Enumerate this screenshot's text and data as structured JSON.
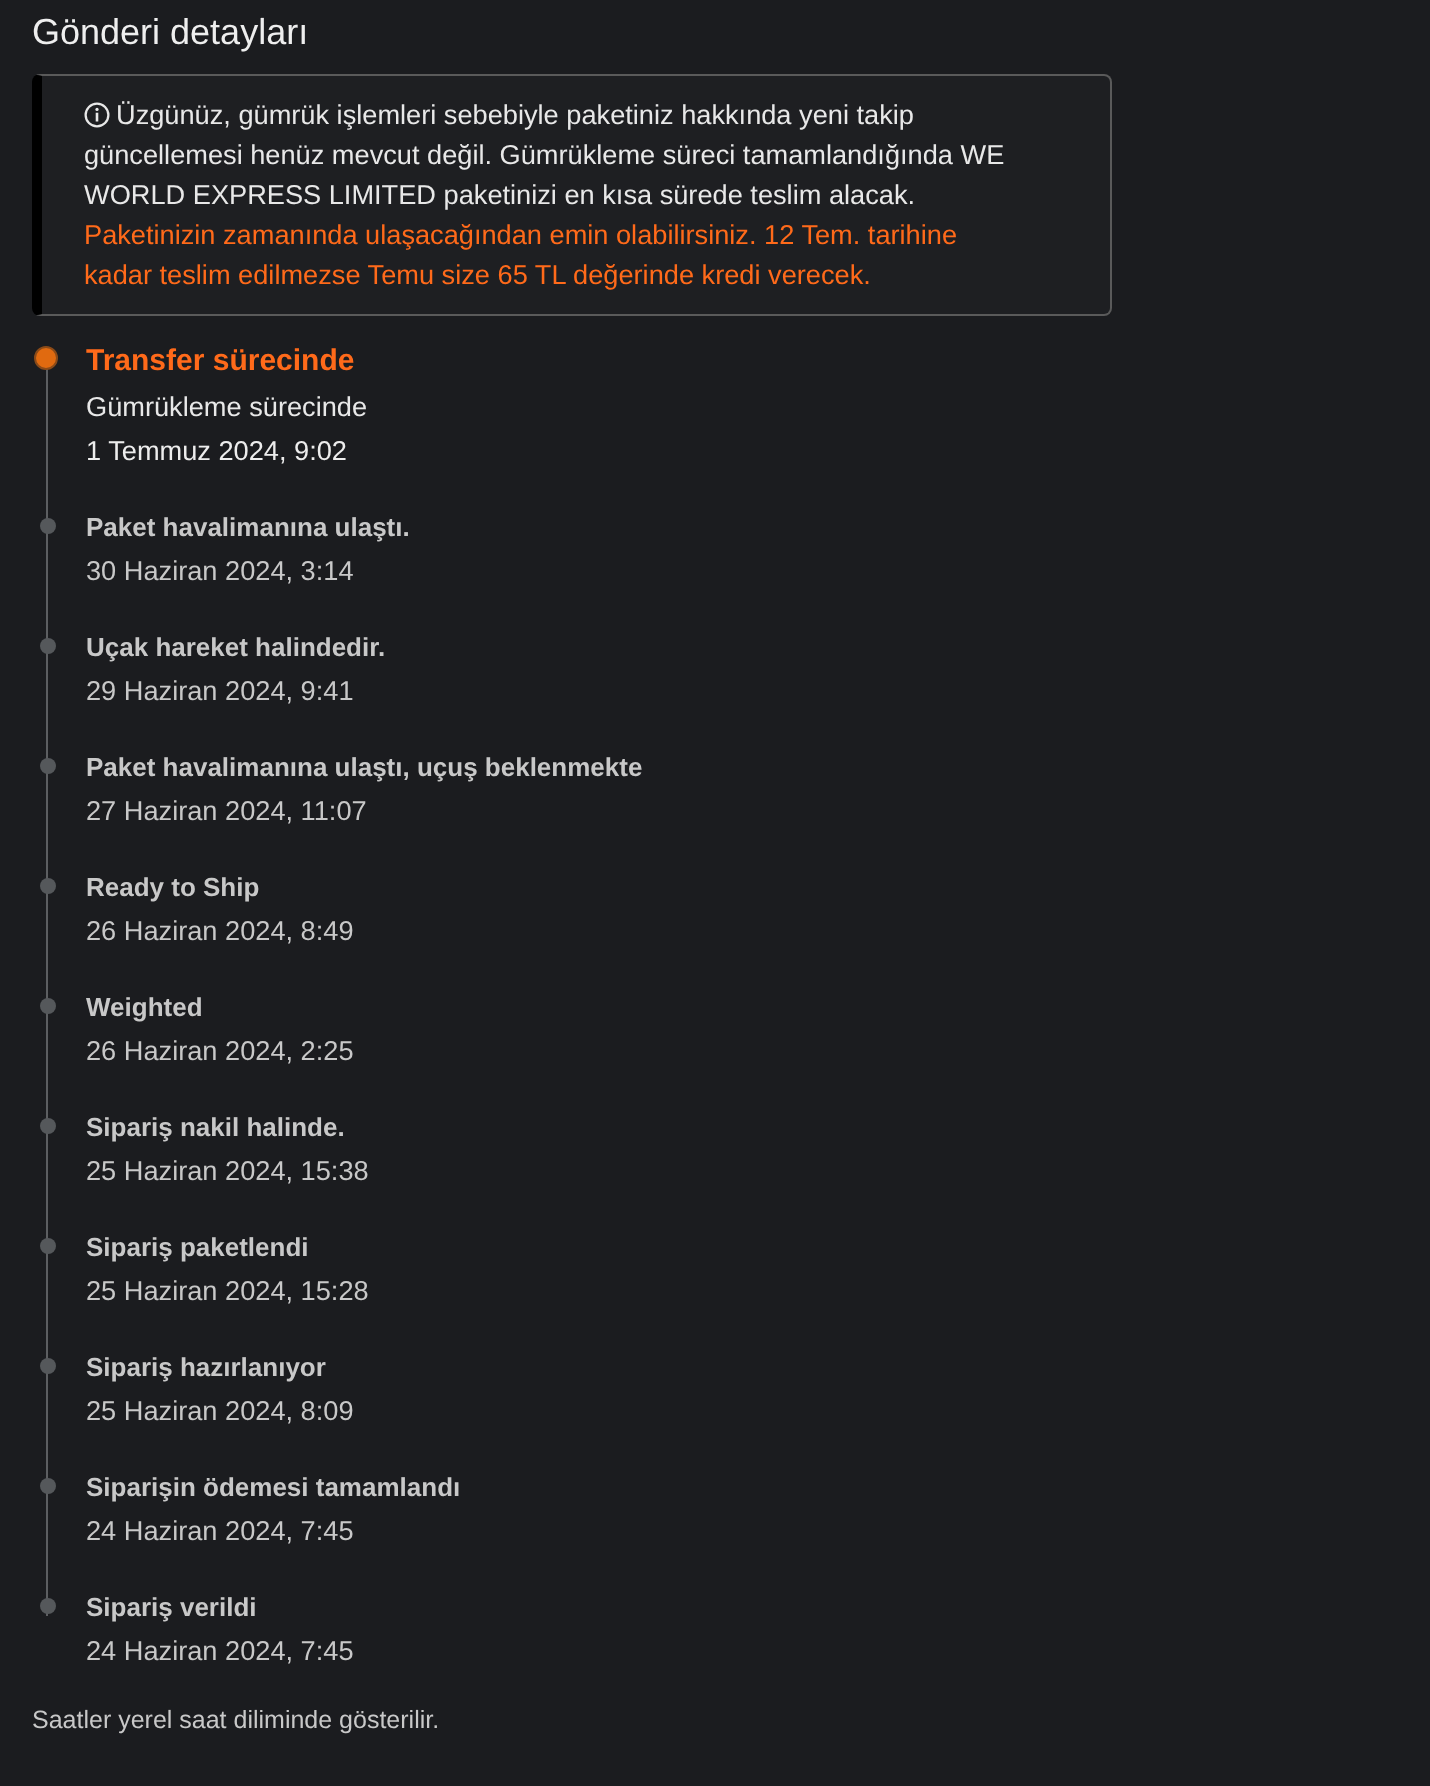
{
  "title": "Gönderi detayları",
  "notice": {
    "text": "Üzgünüz, gümrük işlemleri sebebiyle paketiniz hakkında yeni takip güncellemesi henüz mevcut değil. Gümrükleme süreci tamamlandığında WE WORLD EXPRESS LIMITED paketinizi en kısa sürede teslim alacak.",
    "highlight": "Paketinizin zamanında ulaşacağından emin olabilirsiniz. 12 Tem. tarihine kadar teslim edilmezse Temu size 65 TL değerinde kredi verecek."
  },
  "events": [
    {
      "title": "Transfer sürecinde",
      "detail": "Gümrükleme sürecinde",
      "date": "1 Temmuz 2024, 9:02",
      "current": true
    },
    {
      "title": "Paket havalimanına ulaştı.",
      "date": "30 Haziran 2024, 3:14",
      "current": false
    },
    {
      "title": "Uçak hareket halindedir.",
      "date": "29 Haziran 2024, 9:41",
      "current": false
    },
    {
      "title": "Paket havalimanına ulaştı, uçuş beklenmekte",
      "date": "27 Haziran 2024, 11:07",
      "current": false
    },
    {
      "title": "Ready to Ship",
      "date": "26 Haziran 2024, 8:49",
      "current": false
    },
    {
      "title": "Weighted",
      "date": "26 Haziran 2024, 2:25",
      "current": false
    },
    {
      "title": "Sipariş nakil halinde.",
      "date": "25 Haziran 2024, 15:38",
      "current": false
    },
    {
      "title": "Sipariş paketlendi",
      "date": "25 Haziran 2024, 15:28",
      "current": false
    },
    {
      "title": "Sipariş hazırlanıyor",
      "date": "25 Haziran 2024, 8:09",
      "current": false
    },
    {
      "title": "Siparişin ödemesi tamamlandı",
      "date": "24 Haziran 2024, 7:45",
      "current": false
    },
    {
      "title": "Sipariş verildi",
      "date": "24 Haziran 2024, 7:45",
      "current": false
    }
  ],
  "footer": "Saatler yerel saat diliminde gösterilir."
}
